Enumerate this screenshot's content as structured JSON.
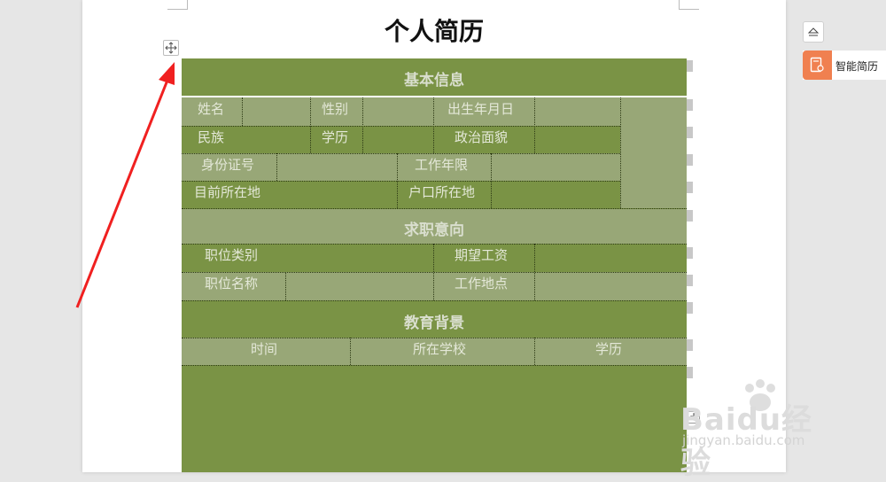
{
  "document": {
    "title": "个人简历"
  },
  "resume_table": {
    "basic_info": {
      "heading": "基本信息",
      "row1": [
        "姓名",
        "性别",
        "出生年月日"
      ],
      "row2": [
        "民族",
        "学历",
        "政治面貌"
      ],
      "row3": [
        "身份证号",
        "工作年限"
      ],
      "row4": [
        "目前所在地",
        "户口所在地"
      ]
    },
    "job_intent": {
      "heading": "求职意向",
      "row1": [
        "职位类别",
        "期望工资"
      ],
      "row2": [
        "职位名称",
        "工作地点"
      ]
    },
    "education": {
      "heading": "教育背景",
      "columns": [
        "时间",
        "所在学校",
        "学历"
      ]
    },
    "colors": {
      "dark": "#7a9345",
      "light": "#98a777"
    }
  },
  "sidebar": {
    "smart_resume_label": "智能简历"
  },
  "watermark": {
    "top": "Baidu经验",
    "bottom": "jingyan.baidu.com"
  },
  "annotation": {
    "arrow_color": "#f02020"
  },
  "icons": [
    "move-icon",
    "add-row-icon",
    "collapse-up-icon",
    "resume-icon"
  ]
}
